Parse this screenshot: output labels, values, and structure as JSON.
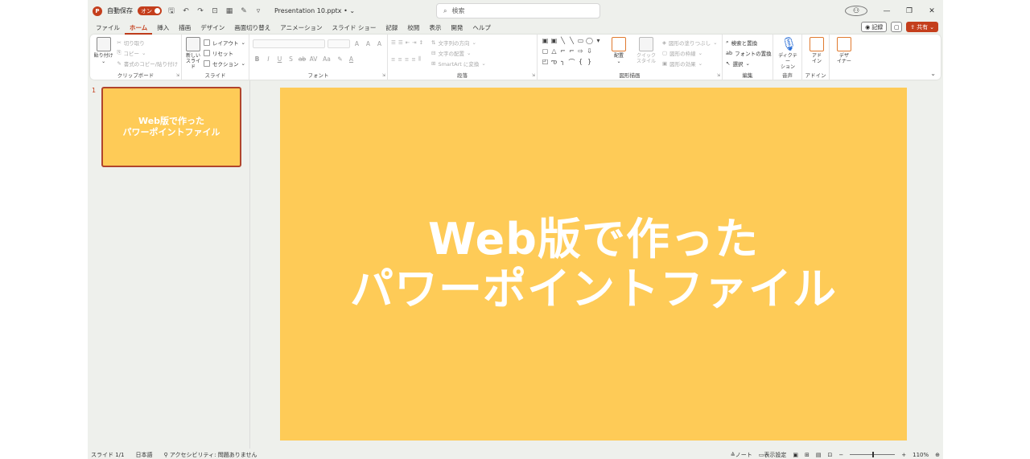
{
  "titlebar": {
    "app_logo": "P",
    "autosave_label": "自動保存",
    "autosave_state": "オン",
    "doc_title": "Presentation 10.pptx",
    "doc_title_suffix": "•",
    "search_placeholder": "検索",
    "window_controls": {
      "minimize": "—",
      "restore": "❐",
      "close": "✕"
    }
  },
  "tabs": [
    {
      "label": "ファイル",
      "active": false
    },
    {
      "label": "ホーム",
      "active": true
    },
    {
      "label": "挿入",
      "active": false
    },
    {
      "label": "描画",
      "active": false
    },
    {
      "label": "デザイン",
      "active": false
    },
    {
      "label": "画面切り替え",
      "active": false
    },
    {
      "label": "アニメーション",
      "active": false
    },
    {
      "label": "スライド ショー",
      "active": false
    },
    {
      "label": "記録",
      "active": false
    },
    {
      "label": "校閲",
      "active": false
    },
    {
      "label": "表示",
      "active": false
    },
    {
      "label": "開発",
      "active": false
    },
    {
      "label": "ヘルプ",
      "active": false
    }
  ],
  "tab_actions": {
    "record": "記録",
    "share": "共有"
  },
  "ribbon": {
    "clipboard": {
      "label": "クリップボード",
      "paste": "貼り付け",
      "cut": "切り取り",
      "copy": "コピー",
      "format_painter": "書式のコピー/貼り付け"
    },
    "slide": {
      "label": "スライド",
      "new_slide_line1": "新しい",
      "new_slide_line2": "スライド",
      "layout": "レイアウト",
      "reset": "リセット",
      "section": "セクション"
    },
    "font": {
      "label": "フォント",
      "bold": "B",
      "italic": "I",
      "underline": "U",
      "shadow": "S",
      "strike": "ab",
      "spacing": "AV",
      "case": "Aa",
      "color": "A"
    },
    "paragraph": {
      "label": "段落",
      "text_direction": "文字列の方向",
      "align_text": "文字の配置",
      "smartart": "SmartArt に変換"
    },
    "drawing": {
      "label": "図形描画",
      "arrange": "配置",
      "quick_styles_line1": "クイック",
      "quick_styles_line2": "スタイル",
      "shape_fill": "図形の塗りつぶし",
      "shape_outline": "図形の枠線",
      "shape_effects": "図形の効果"
    },
    "editing": {
      "label": "編集",
      "find": "検索と置換",
      "replace_fonts": "フォントの置換",
      "select": "選択"
    },
    "voice": {
      "label": "音声",
      "dictate_line1": "ディクテー",
      "dictate_line2": "ション"
    },
    "addins": {
      "label": "アドイン",
      "line1": "アド",
      "line2": "イン"
    },
    "designer": {
      "line1": "デザ",
      "line2": "イナー"
    }
  },
  "slide_panel": {
    "number": "1"
  },
  "slide": {
    "title_line1": "Web版で作った",
    "title_line2": "パワーポイントファイル",
    "background": "#FECB57"
  },
  "statusbar": {
    "slide_count": "スライド 1/1",
    "language": "日本語",
    "accessibility": "アクセシビリティ: 問題ありません",
    "notes": "ノート",
    "display_settings": "表示設定",
    "zoom": "110%"
  },
  "colors": {
    "accent": "#C43E1C"
  }
}
